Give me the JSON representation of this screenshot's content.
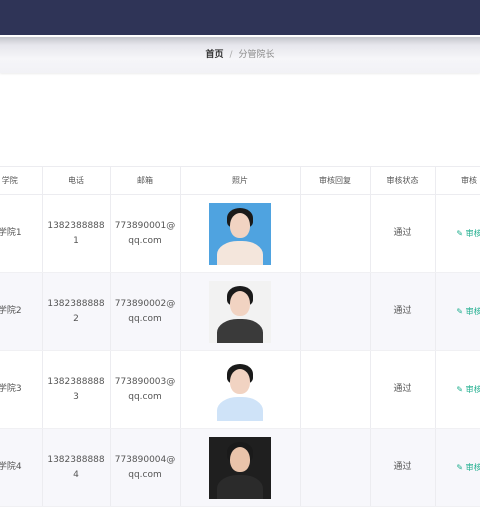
{
  "breadcrumb": {
    "home": "首页",
    "separator": "/",
    "current": "分管院长"
  },
  "table": {
    "columns": [
      "学院",
      "电话",
      "邮箱",
      "照片",
      "审核回复",
      "审核状态",
      "审核"
    ],
    "rows": [
      {
        "college": "学院1",
        "phone": "13823888881",
        "email": "773890001@qq.com",
        "reply": "",
        "status": "通过",
        "action": "审核"
      },
      {
        "college": "学院2",
        "phone": "13823888882",
        "email": "773890002@qq.com",
        "reply": "",
        "status": "通过",
        "action": "审核"
      },
      {
        "college": "学院3",
        "phone": "13823888883",
        "email": "773890003@qq.com",
        "reply": "",
        "status": "通过",
        "action": "审核"
      },
      {
        "college": "学院4",
        "phone": "13823888884",
        "email": "773890004@qq.com",
        "reply": "",
        "status": "通过",
        "action": "审核"
      }
    ]
  },
  "colors": {
    "topbar": "#2f3457",
    "action": "#1fae8e"
  },
  "icons": {
    "action": "edit-icon"
  }
}
